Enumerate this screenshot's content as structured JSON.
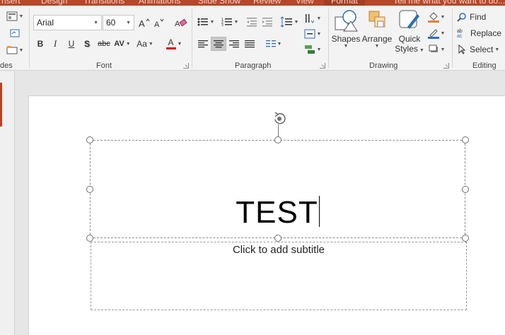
{
  "tabs": [
    {
      "label": "nsert"
    },
    {
      "label": "Design"
    },
    {
      "label": "Transitions"
    },
    {
      "label": "Animations"
    },
    {
      "label": "Slide Show"
    },
    {
      "label": "Review"
    },
    {
      "label": "View"
    },
    {
      "label": "Format"
    },
    {
      "label": "Tell me what you want to do..."
    }
  ],
  "ribbon": {
    "slides_group_label": "des",
    "font": {
      "group_label": "Font",
      "face": "Arial",
      "size": "60",
      "bold": "B",
      "italic": "I",
      "underline": "U",
      "shadow": "S",
      "strike": "abc",
      "spacing": "AV",
      "change_case": "Aa",
      "font_color_glyph": "A",
      "font_color": "#e00000"
    },
    "paragraph": {
      "group_label": "Paragraph"
    },
    "drawing": {
      "group_label": "Drawing",
      "shapes": "Shapes",
      "arrange": "Arrange",
      "quick_styles_1": "Quick",
      "quick_styles_2": "Styles"
    },
    "editing": {
      "group_label": "Editing",
      "find": "Find",
      "replace": "Replace",
      "select": "Select"
    }
  },
  "slide": {
    "title": "TEST",
    "subtitle_placeholder": "Click to add subtitle"
  },
  "colors": {
    "accent": "#b7472a",
    "ribbon_bg": "#f3f3f3",
    "selected_align": "#c8c8c8"
  }
}
